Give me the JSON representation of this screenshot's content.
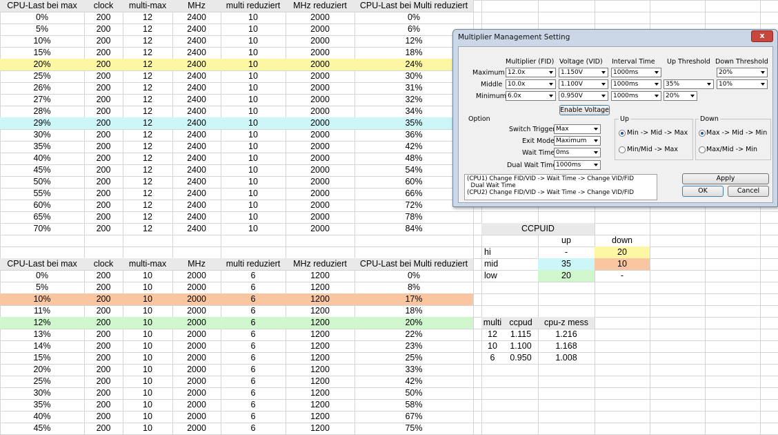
{
  "colors": {
    "yellow": "#fdf7a4",
    "cyan": "#cdf6f8",
    "orange": "#f9c6a1",
    "green": "#d0f6ce",
    "header_gray": "#e9e9e9"
  },
  "table1": {
    "headers": [
      "CPU-Last bei max",
      "clock",
      "multi-max",
      "MHz",
      "multi reduziert",
      "MHz reduziert",
      "CPU-Last bei Multi reduziert"
    ],
    "rows": [
      [
        "0%",
        "200",
        "12",
        "2400",
        "10",
        "2000",
        "0%"
      ],
      [
        "5%",
        "200",
        "12",
        "2400",
        "10",
        "2000",
        "6%"
      ],
      [
        "10%",
        "200",
        "12",
        "2400",
        "10",
        "2000",
        "12%"
      ],
      [
        "15%",
        "200",
        "12",
        "2400",
        "10",
        "2000",
        "18%"
      ],
      [
        "20%",
        "200",
        "12",
        "2400",
        "10",
        "2000",
        "24%"
      ],
      [
        "25%",
        "200",
        "12",
        "2400",
        "10",
        "2000",
        "30%"
      ],
      [
        "26%",
        "200",
        "12",
        "2400",
        "10",
        "2000",
        "31%"
      ],
      [
        "27%",
        "200",
        "12",
        "2400",
        "10",
        "2000",
        "32%"
      ],
      [
        "28%",
        "200",
        "12",
        "2400",
        "10",
        "2000",
        "34%"
      ],
      [
        "29%",
        "200",
        "12",
        "2400",
        "10",
        "2000",
        "35%"
      ],
      [
        "30%",
        "200",
        "12",
        "2400",
        "10",
        "2000",
        "36%"
      ],
      [
        "35%",
        "200",
        "12",
        "2400",
        "10",
        "2000",
        "42%"
      ],
      [
        "40%",
        "200",
        "12",
        "2400",
        "10",
        "2000",
        "48%"
      ],
      [
        "45%",
        "200",
        "12",
        "2400",
        "10",
        "2000",
        "54%"
      ],
      [
        "50%",
        "200",
        "12",
        "2400",
        "10",
        "2000",
        "60%"
      ],
      [
        "55%",
        "200",
        "12",
        "2400",
        "10",
        "2000",
        "66%"
      ],
      [
        "60%",
        "200",
        "12",
        "2400",
        "10",
        "2000",
        "72%"
      ],
      [
        "65%",
        "200",
        "12",
        "2400",
        "10",
        "2000",
        "78%"
      ],
      [
        "70%",
        "200",
        "12",
        "2400",
        "10",
        "2000",
        "84%"
      ]
    ],
    "highlight": {
      "4": "yellow",
      "9": "cyan"
    }
  },
  "table2": {
    "headers": [
      "CPU-Last bei max",
      "clock",
      "multi-max",
      "MHz",
      "multi reduziert",
      "MHz reduziert",
      "CPU-Last bei Multi reduziert"
    ],
    "rows": [
      [
        "0%",
        "200",
        "10",
        "2000",
        "6",
        "1200",
        "0%"
      ],
      [
        "5%",
        "200",
        "10",
        "2000",
        "6",
        "1200",
        "8%"
      ],
      [
        "10%",
        "200",
        "10",
        "2000",
        "6",
        "1200",
        "17%"
      ],
      [
        "11%",
        "200",
        "10",
        "2000",
        "6",
        "1200",
        "18%"
      ],
      [
        "12%",
        "200",
        "10",
        "2000",
        "6",
        "1200",
        "20%"
      ],
      [
        "13%",
        "200",
        "10",
        "2000",
        "6",
        "1200",
        "22%"
      ],
      [
        "14%",
        "200",
        "10",
        "2000",
        "6",
        "1200",
        "23%"
      ],
      [
        "15%",
        "200",
        "10",
        "2000",
        "6",
        "1200",
        "25%"
      ],
      [
        "20%",
        "200",
        "10",
        "2000",
        "6",
        "1200",
        "33%"
      ],
      [
        "25%",
        "200",
        "10",
        "2000",
        "6",
        "1200",
        "42%"
      ],
      [
        "30%",
        "200",
        "10",
        "2000",
        "6",
        "1200",
        "50%"
      ],
      [
        "35%",
        "200",
        "10",
        "2000",
        "6",
        "1200",
        "58%"
      ],
      [
        "40%",
        "200",
        "10",
        "2000",
        "6",
        "1200",
        "67%"
      ],
      [
        "45%",
        "200",
        "10",
        "2000",
        "6",
        "1200",
        "75%"
      ]
    ],
    "highlight": {
      "2": "orange",
      "4": "green"
    }
  },
  "ccpuid": {
    "title": "CCPUID",
    "col_up": "up",
    "col_down": "down",
    "rows": [
      {
        "label": "hi",
        "up": "-",
        "down": "20"
      },
      {
        "label": "mid",
        "up": "35",
        "down": "10"
      },
      {
        "label": "low",
        "up": "20",
        "down": "-"
      }
    ]
  },
  "voltages": {
    "headers": [
      "multi",
      "ccpud",
      "cpu-z mess"
    ],
    "rows": [
      [
        "12",
        "1.115",
        "1.216"
      ],
      [
        "10",
        "1.100",
        "1.168"
      ],
      [
        "6",
        "0.950",
        "1.008"
      ]
    ]
  },
  "dialog": {
    "title": "Multiplier Management Setting",
    "close_label": "x",
    "col_headers": [
      "Multiplier (FID)",
      "Voltage (VID)",
      "Interval Time",
      "Up Threshold",
      "Down Threshold"
    ],
    "row_labels": [
      "Maximum",
      "Middle",
      "Minimum"
    ],
    "rows": [
      {
        "fid": "12.0x",
        "vid": "1.150V",
        "interval": "1000ms",
        "up": "",
        "down": "20%"
      },
      {
        "fid": "10.0x",
        "vid": "1.100V",
        "interval": "1000ms",
        "up": "35%",
        "down": "10%"
      },
      {
        "fid": "6.0x",
        "vid": "0.950V",
        "interval": "1000ms",
        "up": "20%",
        "down": ""
      }
    ],
    "enable_voltage": "Enable Voltage",
    "option_title": "Option",
    "options": [
      {
        "label": "Switch Trigger",
        "value": "Max"
      },
      {
        "label": "Exit Mode",
        "value": "Maximum"
      },
      {
        "label": "Wait Time",
        "value": "0ms"
      },
      {
        "label": "Dual Wait Time",
        "value": "1000ms"
      }
    ],
    "up_group": {
      "title": "Up",
      "opt1": "Min -> Mid -> Max",
      "opt2": "Min/Mid -> Max"
    },
    "down_group": {
      "title": "Down",
      "opt1": "Max -> Mid -> Min",
      "opt2": "Max/Mid -> Min"
    },
    "log_lines": [
      "(CPU1) Change FID/VID -> Wait Time -> Change VID/FID",
      "  Dual Wait Time",
      "(CPU2) Change FID/VID -> Wait Time -> Change VID/FID"
    ],
    "apply": "Apply",
    "ok": "OK",
    "cancel": "Cancel"
  }
}
